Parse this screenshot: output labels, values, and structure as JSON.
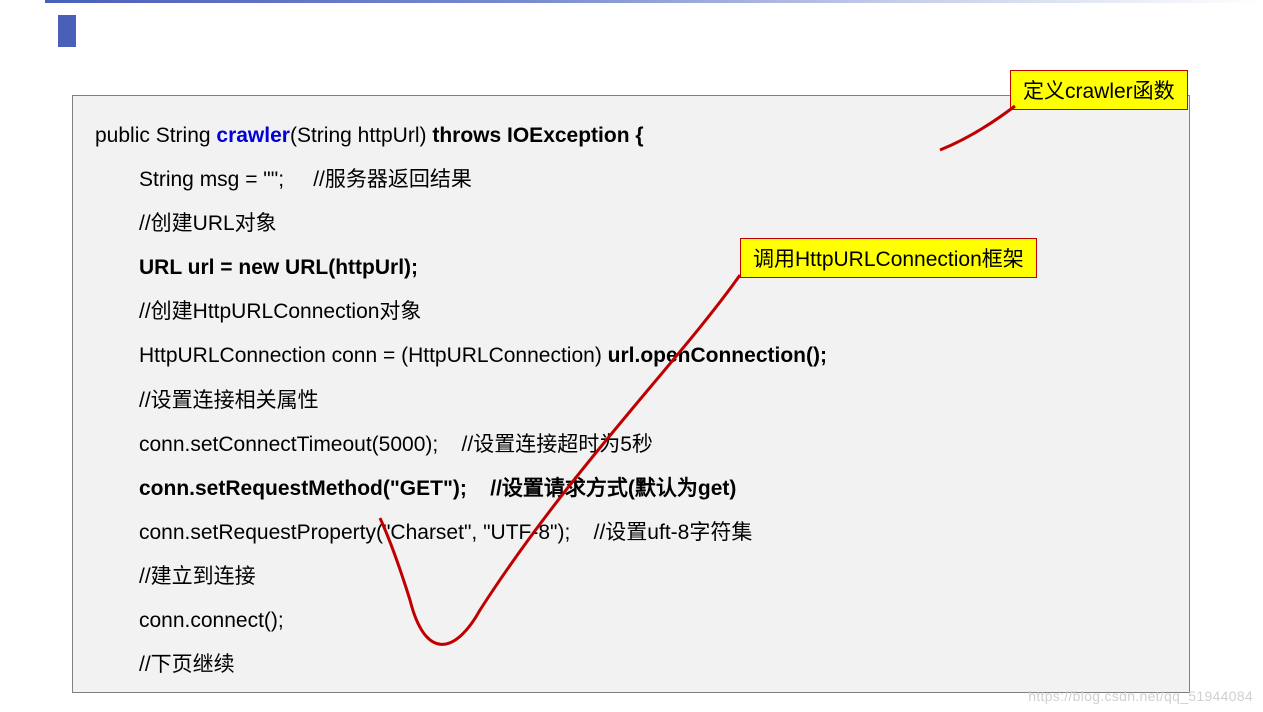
{
  "annotations": {
    "define_crawler": "定义crawler函数",
    "call_httpurlconnection": "调用HttpURLConnection框架"
  },
  "code": {
    "line1_pre": "public String ",
    "line1_kw": "crawler",
    "line1_mid": "(String httpUrl) ",
    "line1_bold": "throws IOException {",
    "line2": "String msg = \"\";     //服务器返回结果",
    "line3": "//创建URL对象",
    "line4": "URL url = new URL(httpUrl);",
    "line5": "//创建HttpURLConnection对象",
    "line6_pre": "HttpURLConnection conn = (HttpURLConnection) ",
    "line6_bold": "url.openConnection();",
    "line7": "//设置连接相关属性",
    "line8": "conn.setConnectTimeout(5000);    //设置连接超时为5秒",
    "line9": "conn.setRequestMethod(\"GET\");    //设置请求方式(默认为get)",
    "line10": "conn.setRequestProperty(\"Charset\", \"UTF-8\");    //设置uft-8字符集",
    "line11": "//建立到连接",
    "line12": "conn.connect();",
    "line13": "//下页继续"
  },
  "watermark": "https://blog.csdn.net/qq_51944084"
}
